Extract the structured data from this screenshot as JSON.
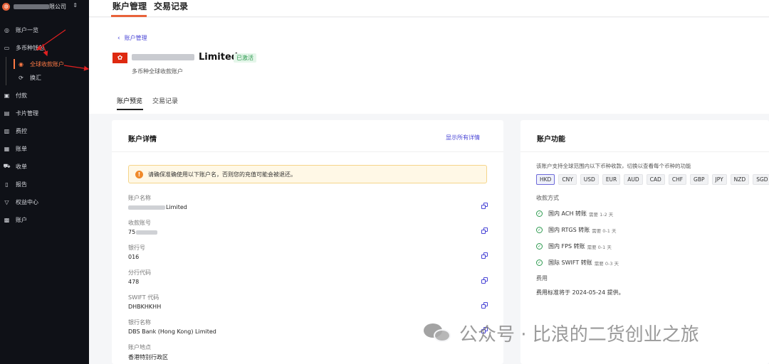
{
  "sidebar": {
    "org_name_suffix": "限公司",
    "items": [
      {
        "label": "账户一览",
        "icon": "dashboard-icon",
        "glyph": "◎"
      },
      {
        "label": "多币种钱包",
        "icon": "wallet-icon",
        "glyph": "▭"
      },
      {
        "label": "全球收款账户",
        "icon": "globe-icon",
        "glyph": "◉"
      },
      {
        "label": "换汇",
        "icon": "exchange-icon",
        "glyph": "⟳"
      },
      {
        "label": "付款",
        "icon": "payment-icon",
        "glyph": "▣"
      },
      {
        "label": "卡片管理",
        "icon": "card-icon",
        "glyph": "▤"
      },
      {
        "label": "费控",
        "icon": "expense-icon",
        "glyph": "▥"
      },
      {
        "label": "账单",
        "icon": "bill-icon",
        "glyph": "▦"
      },
      {
        "label": "收单",
        "icon": "cart-icon",
        "glyph": "⛟"
      },
      {
        "label": "报告",
        "icon": "report-icon",
        "glyph": "▯"
      },
      {
        "label": "权益中心",
        "icon": "filter-icon",
        "glyph": "▽"
      },
      {
        "label": "账户",
        "icon": "store-icon",
        "glyph": "▩"
      }
    ],
    "accent": "#ff7a45"
  },
  "top_tabs": [
    "账户管理",
    "交易记录"
  ],
  "header": {
    "back_label": "账户管理",
    "account_name_suffix": "Limited",
    "status": "已激活",
    "subtitle": "多币种全球收款账户"
  },
  "inner_tabs": [
    "账户预览",
    "交易记录"
  ],
  "details": {
    "title": "账户详情",
    "show_all": "显示所有详情",
    "notice": "请确保准确使用以下账户名，否则您的充值可能会被退还。",
    "fields": [
      {
        "label": "账户名称",
        "value": "Limited",
        "masked": true
      },
      {
        "label": "收款账号",
        "value": "75",
        "masked": true
      },
      {
        "label": "银行号",
        "value": "016",
        "masked": false
      },
      {
        "label": "分行代码",
        "value": "478",
        "masked": false
      },
      {
        "label": "SWIFT 代码",
        "value": "DHBKHKHH",
        "masked": false
      },
      {
        "label": "银行名称",
        "value": "DBS Bank (Hong Kong) Limited",
        "masked": false
      },
      {
        "label": "账户地点",
        "value": "香港特别行政区",
        "masked": false
      }
    ]
  },
  "features": {
    "title": "账户功能",
    "description": "该账户支持全球范围内以下币种收款，切换以查看每个币种的功能",
    "currencies": [
      "HKD",
      "CNY",
      "USD",
      "EUR",
      "AUD",
      "CAD",
      "CHF",
      "GBP",
      "JPY",
      "NZD",
      "SGD"
    ],
    "selected_currency": "HKD",
    "methods_label": "收款方式",
    "methods": [
      {
        "name": "国内 ACH 转账",
        "eta": "需要 1-2 天"
      },
      {
        "name": "国内 RTGS 转账",
        "eta": "需要 0-1 天"
      },
      {
        "name": "国内 FPS 转账",
        "eta": "需要 0-1 天"
      },
      {
        "name": "国际 SWIFT 转账",
        "eta": "需要 0-3 天"
      }
    ],
    "fee_label": "费用",
    "fee_text": "费用标准将于 2024-05-24 提供。"
  },
  "watermark": "公众号 · 比浪的二货创业之旅"
}
